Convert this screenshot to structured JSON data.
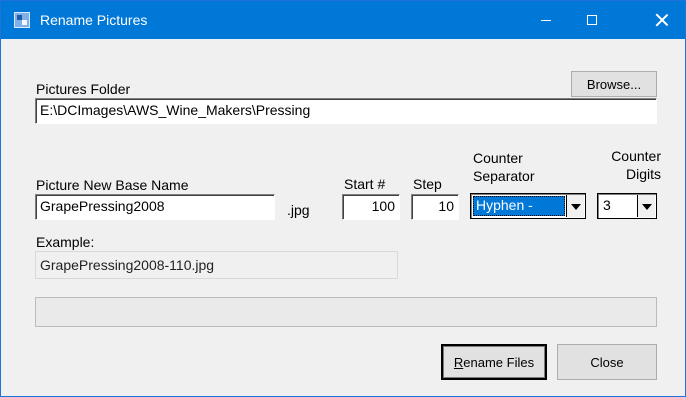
{
  "window": {
    "title": "Rename Pictures"
  },
  "folder": {
    "label": "Pictures Folder",
    "browse_label": "Browse...",
    "path": "E:\\DCImages\\AWS_Wine_Makers\\Pressing"
  },
  "basename": {
    "label": "Picture New Base Name",
    "value": "GrapePressing2008",
    "extension": ".jpg"
  },
  "start": {
    "label": "Start #",
    "value": "100"
  },
  "step": {
    "label": "Step",
    "value": "10"
  },
  "separator": {
    "label": "Counter Separator",
    "value": "Hyphen -"
  },
  "digits": {
    "label": "Counter Digits",
    "value": "3"
  },
  "example": {
    "label": "Example:",
    "value": "GrapePressing2008-110.jpg"
  },
  "progress": {
    "value": 0
  },
  "buttons": {
    "rename_prefix": "R",
    "rename_rest": "ename Files",
    "close": "Close"
  },
  "colors": {
    "titlebar": "#0078d7",
    "selection": "#0078d7",
    "window_bg": "#f0f0f0"
  }
}
